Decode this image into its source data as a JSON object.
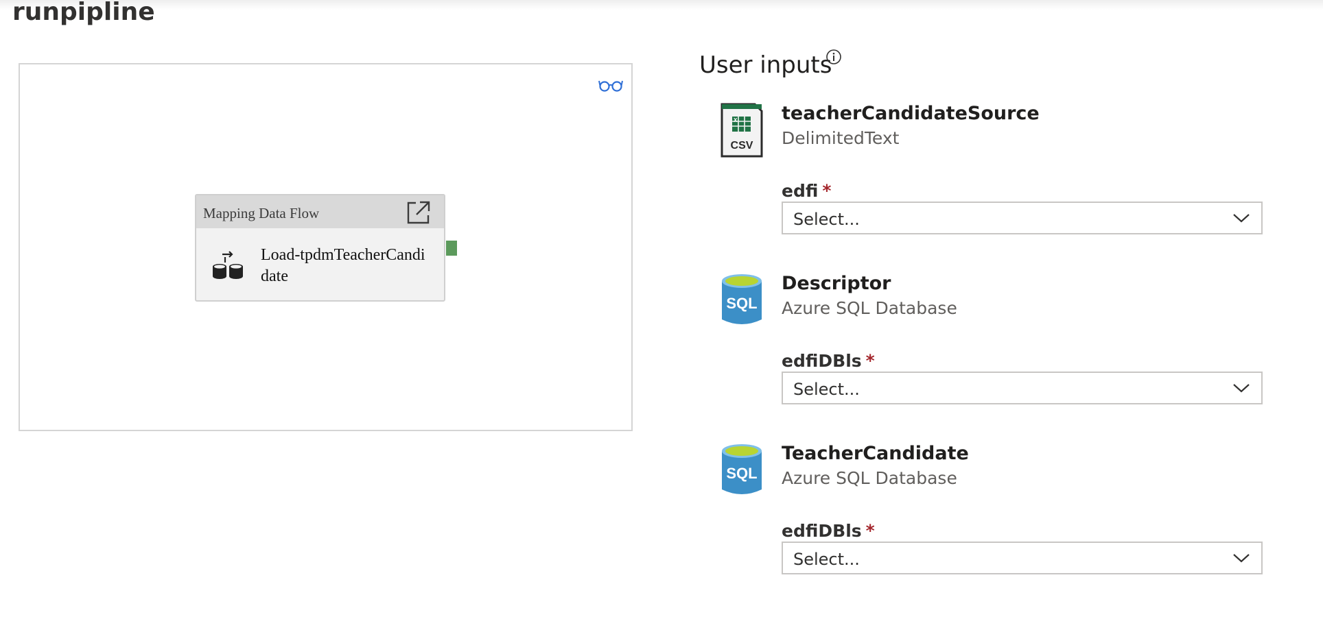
{
  "page": {
    "title": "runpipline"
  },
  "canvas": {
    "activity": {
      "type_label": "Mapping Data Flow",
      "name": "Load-tpdmTeacherCandidate",
      "icon": "dataflow-icon",
      "open_icon": "open-external-icon"
    },
    "view_icon": "glasses-icon"
  },
  "user_inputs": {
    "title": "User inputs",
    "info_icon": "info-icon",
    "sources": [
      {
        "name": "teacherCandidateSource",
        "type": "DelimitedText",
        "icon": "csv-file-icon",
        "field_label": "edfi",
        "required_mark": "*",
        "dropdown_value": "Select..."
      },
      {
        "name": "Descriptor",
        "type": "Azure SQL Database",
        "icon": "sql-database-icon",
        "field_label": "edfiDBls",
        "required_mark": "*",
        "dropdown_value": "Select..."
      },
      {
        "name": "TeacherCandidate",
        "type": "Azure SQL Database",
        "icon": "sql-database-icon",
        "field_label": "edfiDBls",
        "required_mark": "*",
        "dropdown_value": "Select..."
      }
    ]
  },
  "colors": {
    "required": "#a4262c",
    "port": "#5c9a5c",
    "sql_blue": "#3c8fc7",
    "sql_top": "#b8d432",
    "csv_green": "#217346"
  }
}
